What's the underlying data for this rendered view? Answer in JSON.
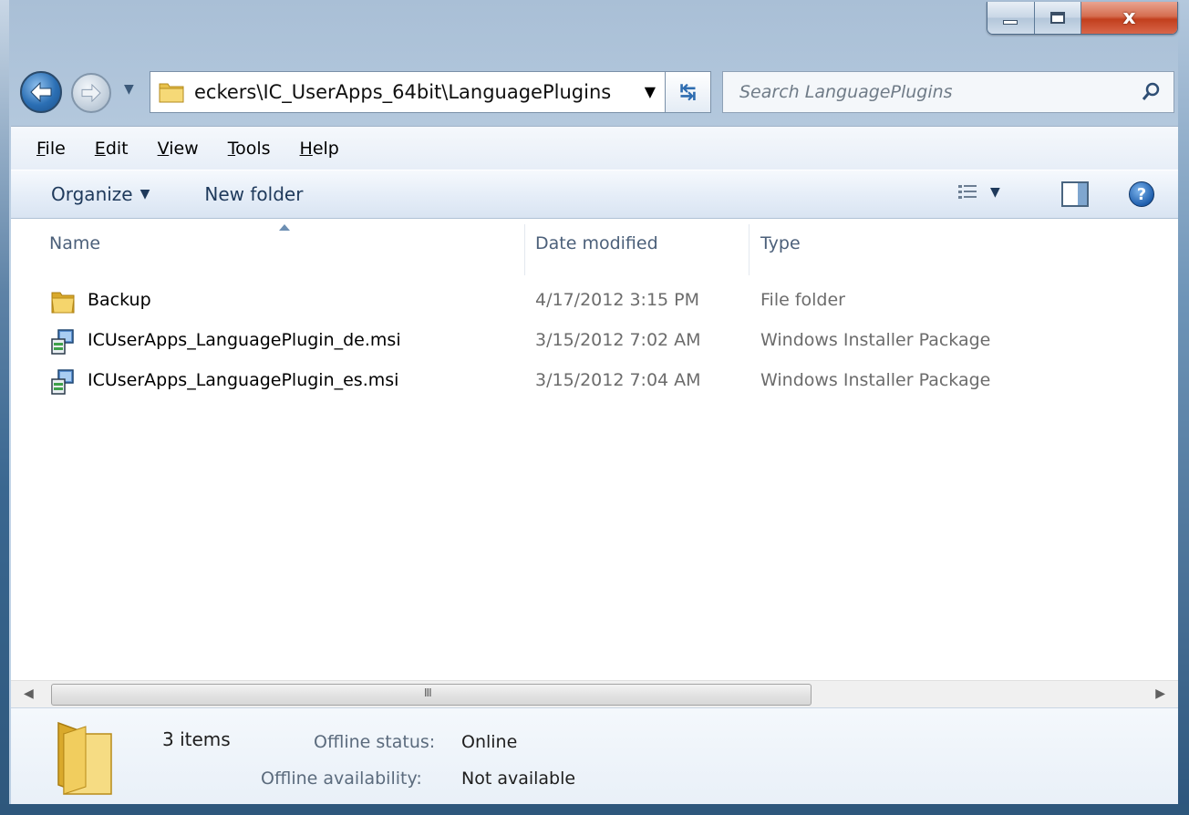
{
  "window": {
    "caption": {
      "minimize_icon": "minimize-icon",
      "maximize_icon": "maximize-icon",
      "close_glyph": "x"
    }
  },
  "nav": {
    "address_path": "eckers\\IC_UserApps_64bit\\LanguagePlugins",
    "search_placeholder": "Search LanguagePlugins",
    "back_icon": "back-arrow-icon",
    "forward_icon": "forward-arrow-icon",
    "refresh_icon": "refresh-icon"
  },
  "menu": {
    "items": [
      {
        "acc": "F",
        "rest": "ile"
      },
      {
        "acc": "E",
        "rest": "dit"
      },
      {
        "acc": "V",
        "rest": "iew"
      },
      {
        "acc": "T",
        "rest": "ools"
      },
      {
        "acc": "H",
        "rest": "elp"
      }
    ]
  },
  "toolbar": {
    "organize_label": "Organize",
    "new_folder_label": "New folder",
    "help_glyph": "?"
  },
  "columns": {
    "name": "Name",
    "date_modified": "Date modified",
    "type": "Type"
  },
  "files": [
    {
      "name": "Backup",
      "date": "4/17/2012 3:15 PM",
      "type": "File folder",
      "icon": "folder-icon"
    },
    {
      "name": "ICUserApps_LanguagePlugin_de.msi",
      "date": "3/15/2012 7:02 AM",
      "type": "Windows Installer Package",
      "icon": "msi-installer-icon"
    },
    {
      "name": "ICUserApps_LanguagePlugin_es.msi",
      "date": "3/15/2012 7:04 AM",
      "type": "Windows Installer Package",
      "icon": "msi-installer-icon"
    }
  ],
  "scrollbar": {
    "grip": "III"
  },
  "details": {
    "count": "3 items",
    "offline_status_label": "Offline status:",
    "offline_status_value": "Online",
    "offline_availability_label": "Offline availability:",
    "offline_availability_value": "Not available"
  },
  "colors": {
    "accent": "#2b6fb4",
    "header_text": "#4c607a",
    "secondary_text": "#6c6c6c"
  }
}
